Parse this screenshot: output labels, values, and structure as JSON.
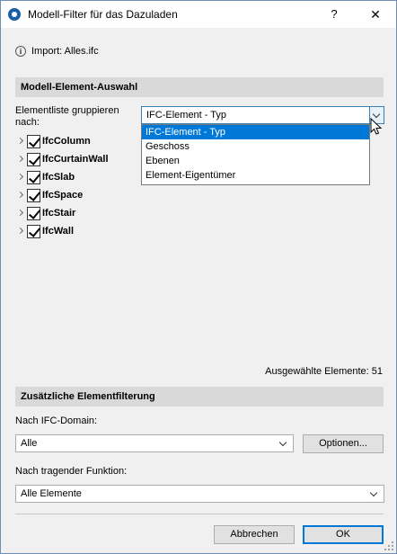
{
  "window": {
    "title": "Modell-Filter für das Dazuladen",
    "help_label": "?",
    "close_label": "✕"
  },
  "info": {
    "icon": "info-icon",
    "text": "Import: Alles.ifc"
  },
  "section_model": {
    "title": "Modell-Element-Auswahl",
    "group_label": "Elementliste gruppieren nach:",
    "group_value": "IFC-Element - Typ",
    "group_options": [
      "IFC-Element - Typ",
      "Geschoss",
      "Ebenen",
      "Element-Eigentümer"
    ],
    "tree_items": [
      {
        "label": "IfcColumn",
        "checked": true
      },
      {
        "label": "IfcCurtainWall",
        "checked": true
      },
      {
        "label": "IfcSlab",
        "checked": true
      },
      {
        "label": "IfcSpace",
        "checked": true
      },
      {
        "label": "IfcStair",
        "checked": true
      },
      {
        "label": "IfcWall",
        "checked": true
      }
    ],
    "selected_count": "Ausgewählte Elemente: 51"
  },
  "section_filter": {
    "title": "Zusätzliche Elementfilterung",
    "domain_label": "Nach IFC-Domain:",
    "domain_value": "Alle",
    "options_button": "Optionen...",
    "function_label": "Nach tragender Funktion:",
    "function_value": "Alle Elemente"
  },
  "buttons": {
    "cancel": "Abbrechen",
    "ok": "OK"
  }
}
